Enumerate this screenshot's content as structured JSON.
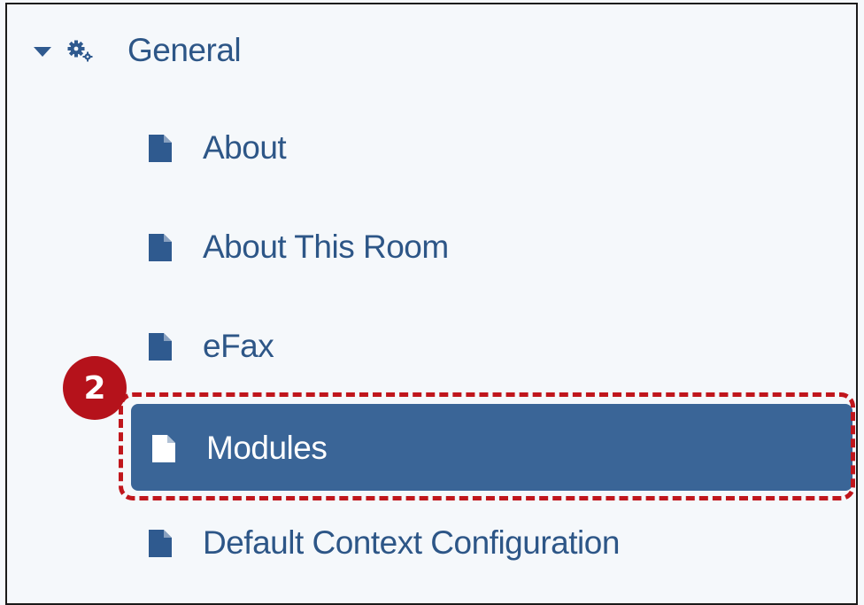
{
  "tree": {
    "header": {
      "label": "General",
      "expand_icon": "caret-down-icon",
      "icon": "gears-icon"
    },
    "items": [
      {
        "label": "About",
        "icon": "document-icon",
        "selected": false
      },
      {
        "label": "About This Room",
        "icon": "document-icon",
        "selected": false
      },
      {
        "label": "eFax",
        "icon": "document-icon",
        "selected": false
      },
      {
        "label": "Modules",
        "icon": "document-icon",
        "selected": true
      },
      {
        "label": "Default Context Configuration",
        "icon": "document-icon",
        "selected": false
      }
    ]
  },
  "annotation": {
    "step_number": "2"
  },
  "colors": {
    "text": "#2d5687",
    "selected_bg": "#3a6597",
    "selected_text": "#ffffff",
    "highlight": "#c0161c",
    "panel_bg": "#f5f8fb"
  }
}
